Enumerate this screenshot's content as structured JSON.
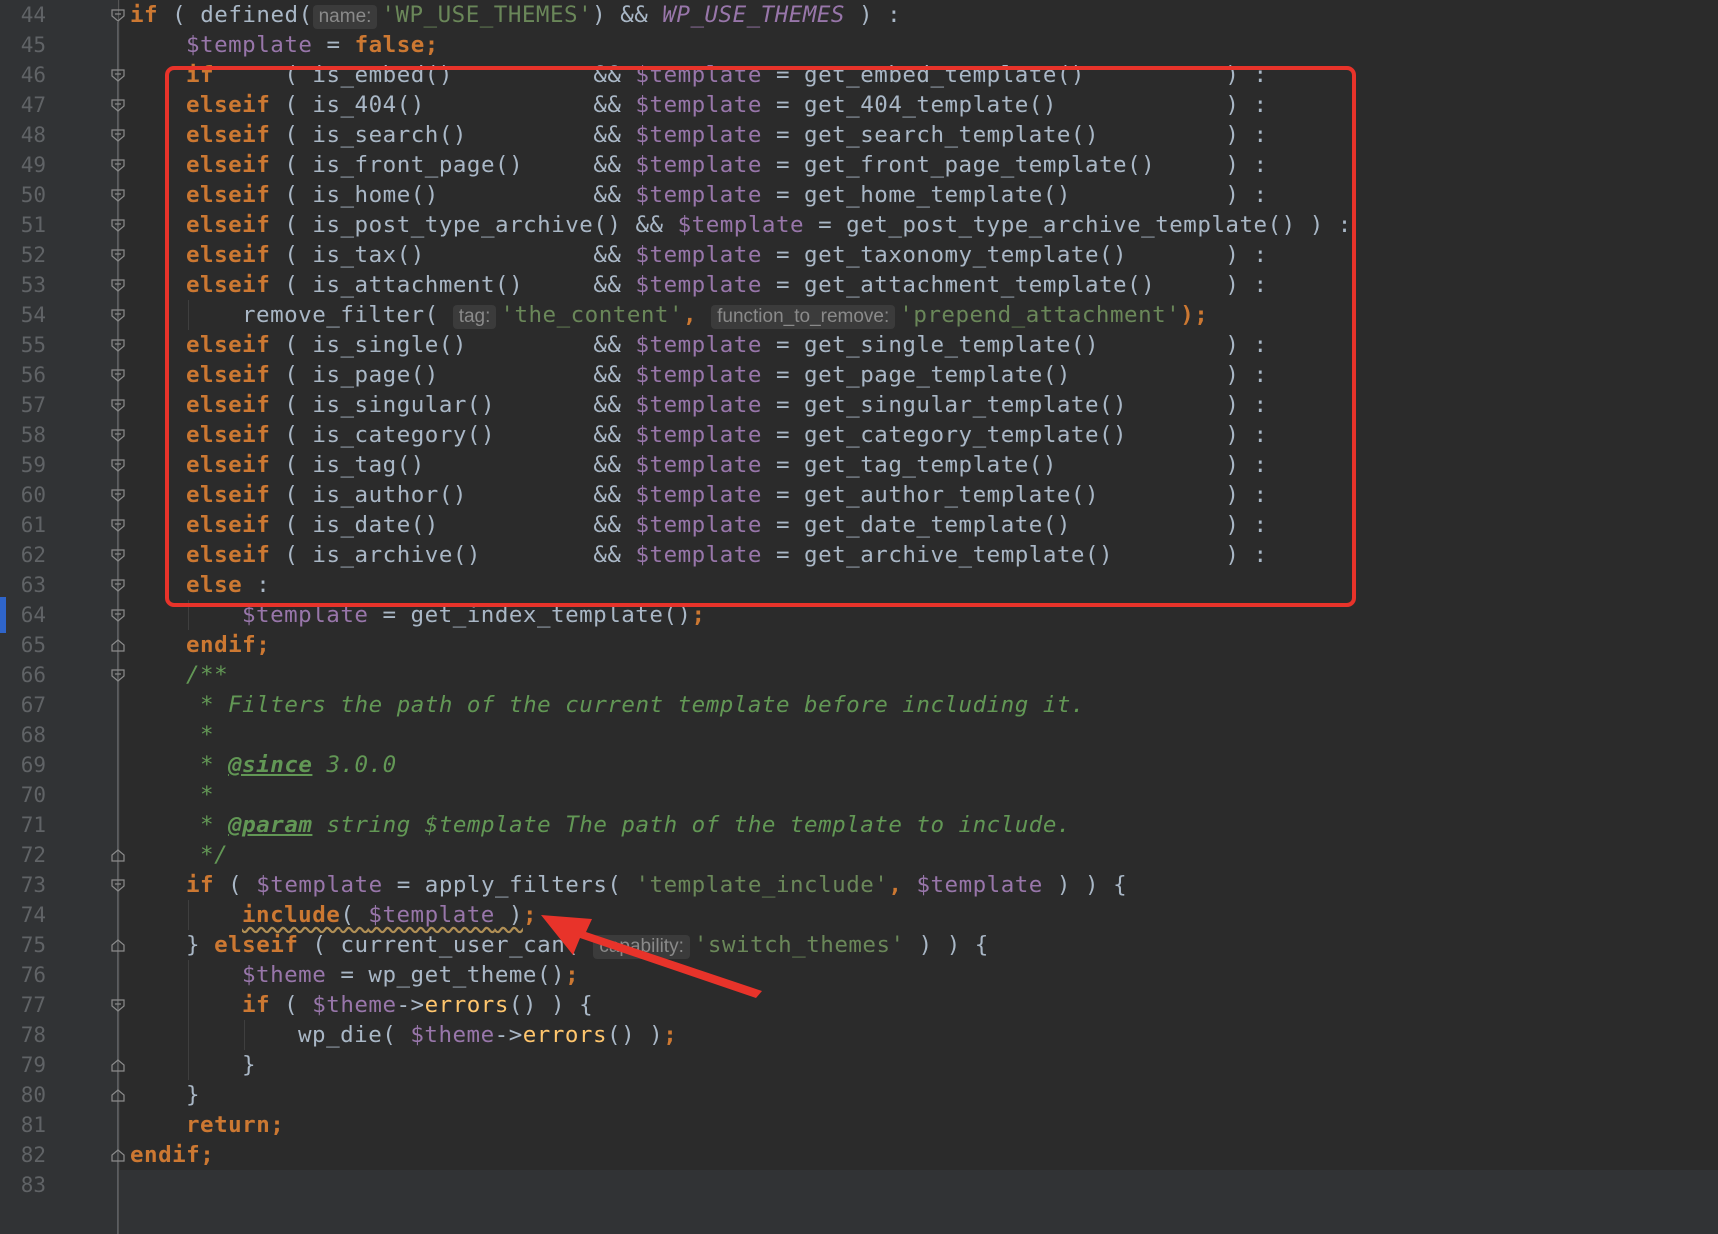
{
  "editor": {
    "lines": [
      {
        "n": "44",
        "fold": "open",
        "indent": 0,
        "tokens": [
          {
            "t": "if",
            "c": "k"
          },
          {
            "t": " ( ",
            "c": "f"
          },
          {
            "t": "defined",
            "c": "f"
          },
          {
            "t": "(",
            "c": "f"
          },
          {
            "hint": "name:"
          },
          {
            "t": "'WP_USE_THEMES'",
            "c": "s"
          },
          {
            "t": ") && ",
            "c": "f"
          },
          {
            "t": "WP_USE_THEMES",
            "c": "cn"
          },
          {
            "t": " ) :",
            "c": "f"
          }
        ]
      },
      {
        "n": "45",
        "fold": "",
        "indent": 1,
        "tokens": [
          {
            "t": "$template",
            "c": "v"
          },
          {
            "t": " = ",
            "c": "f"
          },
          {
            "t": "false",
            "c": "k"
          },
          {
            "t": ";",
            "c": "k"
          }
        ]
      },
      {
        "n": "46",
        "fold": "open",
        "indent": 1,
        "tokens": [
          {
            "t": "if",
            "c": "k"
          },
          {
            "t": "     ( is_embed()          && ",
            "c": "f"
          },
          {
            "t": "$template",
            "c": "v"
          },
          {
            "t": " = get_embed_template()          ) :",
            "c": "f"
          }
        ]
      },
      {
        "n": "47",
        "fold": "mid",
        "indent": 1,
        "tokens": [
          {
            "t": "elseif",
            "c": "k"
          },
          {
            "t": " ( is_404()            && ",
            "c": "f"
          },
          {
            "t": "$template",
            "c": "v"
          },
          {
            "t": " = get_404_template()            ) :",
            "c": "f"
          }
        ]
      },
      {
        "n": "48",
        "fold": "mid",
        "indent": 1,
        "tokens": [
          {
            "t": "elseif",
            "c": "k"
          },
          {
            "t": " ( is_search()         && ",
            "c": "f"
          },
          {
            "t": "$template",
            "c": "v"
          },
          {
            "t": " = get_search_template()         ) :",
            "c": "f"
          }
        ]
      },
      {
        "n": "49",
        "fold": "mid",
        "indent": 1,
        "tokens": [
          {
            "t": "elseif",
            "c": "k"
          },
          {
            "t": " ( is_front_page()     && ",
            "c": "f"
          },
          {
            "t": "$template",
            "c": "v"
          },
          {
            "t": " = get_front_page_template()     ) :",
            "c": "f"
          }
        ]
      },
      {
        "n": "50",
        "fold": "mid",
        "indent": 1,
        "tokens": [
          {
            "t": "elseif",
            "c": "k"
          },
          {
            "t": " ( is_home()           && ",
            "c": "f"
          },
          {
            "t": "$template",
            "c": "v"
          },
          {
            "t": " = get_home_template()           ) :",
            "c": "f"
          }
        ]
      },
      {
        "n": "51",
        "fold": "mid",
        "indent": 1,
        "tokens": [
          {
            "t": "elseif",
            "c": "k"
          },
          {
            "t": " ( is_post_type_archive() && ",
            "c": "f"
          },
          {
            "t": "$template",
            "c": "v"
          },
          {
            "t": " = get_post_type_archive_template() ) :",
            "c": "f"
          }
        ]
      },
      {
        "n": "52",
        "fold": "mid",
        "indent": 1,
        "tokens": [
          {
            "t": "elseif",
            "c": "k"
          },
          {
            "t": " ( is_tax()            && ",
            "c": "f"
          },
          {
            "t": "$template",
            "c": "v"
          },
          {
            "t": " = get_taxonomy_template()       ) :",
            "c": "f"
          }
        ]
      },
      {
        "n": "53",
        "fold": "mid",
        "indent": 1,
        "tokens": [
          {
            "t": "elseif",
            "c": "k"
          },
          {
            "t": " ( is_attachment()     && ",
            "c": "f"
          },
          {
            "t": "$template",
            "c": "v"
          },
          {
            "t": " = get_attachment_template()     ) :",
            "c": "f"
          }
        ]
      },
      {
        "n": "54",
        "fold": "mid",
        "indent": 2,
        "guides": [
          1
        ],
        "tokens": [
          {
            "t": "remove_filter",
            "c": "f"
          },
          {
            "t": "( ",
            "c": "f"
          },
          {
            "hint": "tag:"
          },
          {
            "t": "'the_content'",
            "c": "s"
          },
          {
            "t": ", ",
            "c": "k"
          },
          {
            "hint": "function_to_remove:"
          },
          {
            "t": "'prepend_attachment'",
            "c": "s"
          },
          {
            "t": ");",
            "c": "k"
          }
        ]
      },
      {
        "n": "55",
        "fold": "mid",
        "indent": 1,
        "tokens": [
          {
            "t": "elseif",
            "c": "k"
          },
          {
            "t": " ( is_single()         && ",
            "c": "f"
          },
          {
            "t": "$template",
            "c": "v"
          },
          {
            "t": " = get_single_template()         ) :",
            "c": "f"
          }
        ]
      },
      {
        "n": "56",
        "fold": "mid",
        "indent": 1,
        "tokens": [
          {
            "t": "elseif",
            "c": "k"
          },
          {
            "t": " ( is_page()           && ",
            "c": "f"
          },
          {
            "t": "$template",
            "c": "v"
          },
          {
            "t": " = get_page_template()           ) :",
            "c": "f"
          }
        ]
      },
      {
        "n": "57",
        "fold": "mid",
        "indent": 1,
        "tokens": [
          {
            "t": "elseif",
            "c": "k"
          },
          {
            "t": " ( is_singular()       && ",
            "c": "f"
          },
          {
            "t": "$template",
            "c": "v"
          },
          {
            "t": " = get_singular_template()       ) :",
            "c": "f"
          }
        ]
      },
      {
        "n": "58",
        "fold": "mid",
        "indent": 1,
        "tokens": [
          {
            "t": "elseif",
            "c": "k"
          },
          {
            "t": " ( is_category()       && ",
            "c": "f"
          },
          {
            "t": "$template",
            "c": "v"
          },
          {
            "t": " = get_category_template()       ) :",
            "c": "f"
          }
        ]
      },
      {
        "n": "59",
        "fold": "mid",
        "indent": 1,
        "tokens": [
          {
            "t": "elseif",
            "c": "k"
          },
          {
            "t": " ( is_tag()            && ",
            "c": "f"
          },
          {
            "t": "$template",
            "c": "v"
          },
          {
            "t": " = get_tag_template()            ) :",
            "c": "f"
          }
        ]
      },
      {
        "n": "60",
        "fold": "mid",
        "indent": 1,
        "tokens": [
          {
            "t": "elseif",
            "c": "k"
          },
          {
            "t": " ( is_author()         && ",
            "c": "f"
          },
          {
            "t": "$template",
            "c": "v"
          },
          {
            "t": " = get_author_template()         ) :",
            "c": "f"
          }
        ]
      },
      {
        "n": "61",
        "fold": "mid",
        "indent": 1,
        "tokens": [
          {
            "t": "elseif",
            "c": "k"
          },
          {
            "t": " ( is_date()           && ",
            "c": "f"
          },
          {
            "t": "$template",
            "c": "v"
          },
          {
            "t": " = get_date_template()           ) :",
            "c": "f"
          }
        ]
      },
      {
        "n": "62",
        "fold": "mid",
        "indent": 1,
        "tokens": [
          {
            "t": "elseif",
            "c": "k"
          },
          {
            "t": " ( is_archive()        && ",
            "c": "f"
          },
          {
            "t": "$template",
            "c": "v"
          },
          {
            "t": " = get_archive_template()        ) :",
            "c": "f"
          }
        ]
      },
      {
        "n": "63",
        "fold": "mid",
        "indent": 1,
        "tokens": [
          {
            "t": "else",
            "c": "k"
          },
          {
            "t": " :",
            "c": "f"
          }
        ]
      },
      {
        "n": "64",
        "fold": "mid",
        "indent": 2,
        "guides": [
          1
        ],
        "tokens": [
          {
            "t": "$template",
            "c": "v"
          },
          {
            "t": " = get_index_template()",
            "c": "f"
          },
          {
            "t": ";",
            "c": "k"
          }
        ]
      },
      {
        "n": "65",
        "fold": "close",
        "indent": 1,
        "tokens": [
          {
            "t": "endif",
            "c": "k"
          },
          {
            "t": ";",
            "c": "k"
          }
        ]
      },
      {
        "n": "66",
        "fold": "open",
        "indent": 1,
        "tokens": [
          {
            "t": "/**",
            "c": "c"
          }
        ]
      },
      {
        "n": "67",
        "fold": "",
        "indent": 1,
        "tokens": [
          {
            "t": " * Filters the path of the current template before including it.",
            "c": "c"
          }
        ]
      },
      {
        "n": "68",
        "fold": "",
        "indent": 1,
        "tokens": [
          {
            "t": " *",
            "c": "c"
          }
        ]
      },
      {
        "n": "69",
        "fold": "",
        "indent": 1,
        "tokens": [
          {
            "t": " * ",
            "c": "c"
          },
          {
            "t": "@since",
            "c": "ct"
          },
          {
            "t": " 3.0.0",
            "c": "c"
          }
        ]
      },
      {
        "n": "70",
        "fold": "",
        "indent": 1,
        "tokens": [
          {
            "t": " *",
            "c": "c"
          }
        ]
      },
      {
        "n": "71",
        "fold": "",
        "indent": 1,
        "tokens": [
          {
            "t": " * ",
            "c": "c"
          },
          {
            "t": "@param",
            "c": "ct"
          },
          {
            "t": " string $template The path of the template to include.",
            "c": "c"
          }
        ]
      },
      {
        "n": "72",
        "fold": "close",
        "indent": 1,
        "tokens": [
          {
            "t": " */",
            "c": "c"
          }
        ]
      },
      {
        "n": "73",
        "fold": "open",
        "indent": 1,
        "tokens": [
          {
            "t": "if",
            "c": "k"
          },
          {
            "t": " ( ",
            "c": "f"
          },
          {
            "t": "$template",
            "c": "v"
          },
          {
            "t": " = apply_filters( ",
            "c": "f"
          },
          {
            "t": "'template_include'",
            "c": "s"
          },
          {
            "t": ", ",
            "c": "k"
          },
          {
            "t": "$template",
            "c": "v"
          },
          {
            "t": " ) ) {",
            "c": "f"
          }
        ]
      },
      {
        "n": "74",
        "fold": "",
        "indent": 2,
        "guides": [
          1
        ],
        "tokens": [
          {
            "t": "include",
            "c": "k",
            "sq": true
          },
          {
            "t": "( ",
            "c": "f",
            "sq": true
          },
          {
            "t": "$template",
            "c": "v",
            "sq": true
          },
          {
            "t": " )",
            "c": "f",
            "sq": true
          },
          {
            "t": ";",
            "c": "k"
          }
        ]
      },
      {
        "n": "75",
        "fold": "close",
        "indent": 1,
        "tokens": [
          {
            "t": "} ",
            "c": "f"
          },
          {
            "t": "elseif",
            "c": "k"
          },
          {
            "t": " ( current_user_can( ",
            "c": "f"
          },
          {
            "hint": "capability:"
          },
          {
            "t": "'switch_themes'",
            "c": "s"
          },
          {
            "t": " ) ) {",
            "c": "f"
          }
        ]
      },
      {
        "n": "76",
        "fold": "",
        "indent": 2,
        "guides": [
          1
        ],
        "tokens": [
          {
            "t": "$theme",
            "c": "v"
          },
          {
            "t": " = wp_get_theme()",
            "c": "f"
          },
          {
            "t": ";",
            "c": "k"
          }
        ]
      },
      {
        "n": "77",
        "fold": "open",
        "indent": 2,
        "guides": [
          1
        ],
        "tokens": [
          {
            "t": "if",
            "c": "k"
          },
          {
            "t": " ( ",
            "c": "f"
          },
          {
            "t": "$theme",
            "c": "v"
          },
          {
            "t": "->",
            "c": "f"
          },
          {
            "t": "errors",
            "c": "fy"
          },
          {
            "t": "() ) {",
            "c": "f"
          }
        ]
      },
      {
        "n": "78",
        "fold": "",
        "indent": 3,
        "guides": [
          1,
          2
        ],
        "tokens": [
          {
            "t": "wp_die( ",
            "c": "f"
          },
          {
            "t": "$theme",
            "c": "v"
          },
          {
            "t": "->",
            "c": "f"
          },
          {
            "t": "errors",
            "c": "fy"
          },
          {
            "t": "() )",
            "c": "f"
          },
          {
            "t": ";",
            "c": "k"
          }
        ]
      },
      {
        "n": "79",
        "fold": "close",
        "indent": 2,
        "guides": [
          1
        ],
        "tokens": [
          {
            "t": "}",
            "c": "f"
          }
        ]
      },
      {
        "n": "80",
        "fold": "close",
        "indent": 1,
        "tokens": [
          {
            "t": "}",
            "c": "f"
          }
        ]
      },
      {
        "n": "81",
        "fold": "",
        "indent": 1,
        "tokens": [
          {
            "t": "return",
            "c": "k"
          },
          {
            "t": ";",
            "c": "k"
          }
        ]
      },
      {
        "n": "82",
        "fold": "close",
        "indent": 0,
        "tokens": [
          {
            "t": "endif",
            "c": "k"
          },
          {
            "t": ";",
            "c": "k"
          }
        ]
      },
      {
        "n": "83",
        "fold": "",
        "indent": 0,
        "tokens": []
      }
    ]
  },
  "colors": {
    "background": "#2b2b2b",
    "gutter": "#313335",
    "keyword": "#cc7832",
    "variable": "#9876aa",
    "string": "#6a8759",
    "comment": "#629755",
    "annotation_red": "#e8332a"
  }
}
